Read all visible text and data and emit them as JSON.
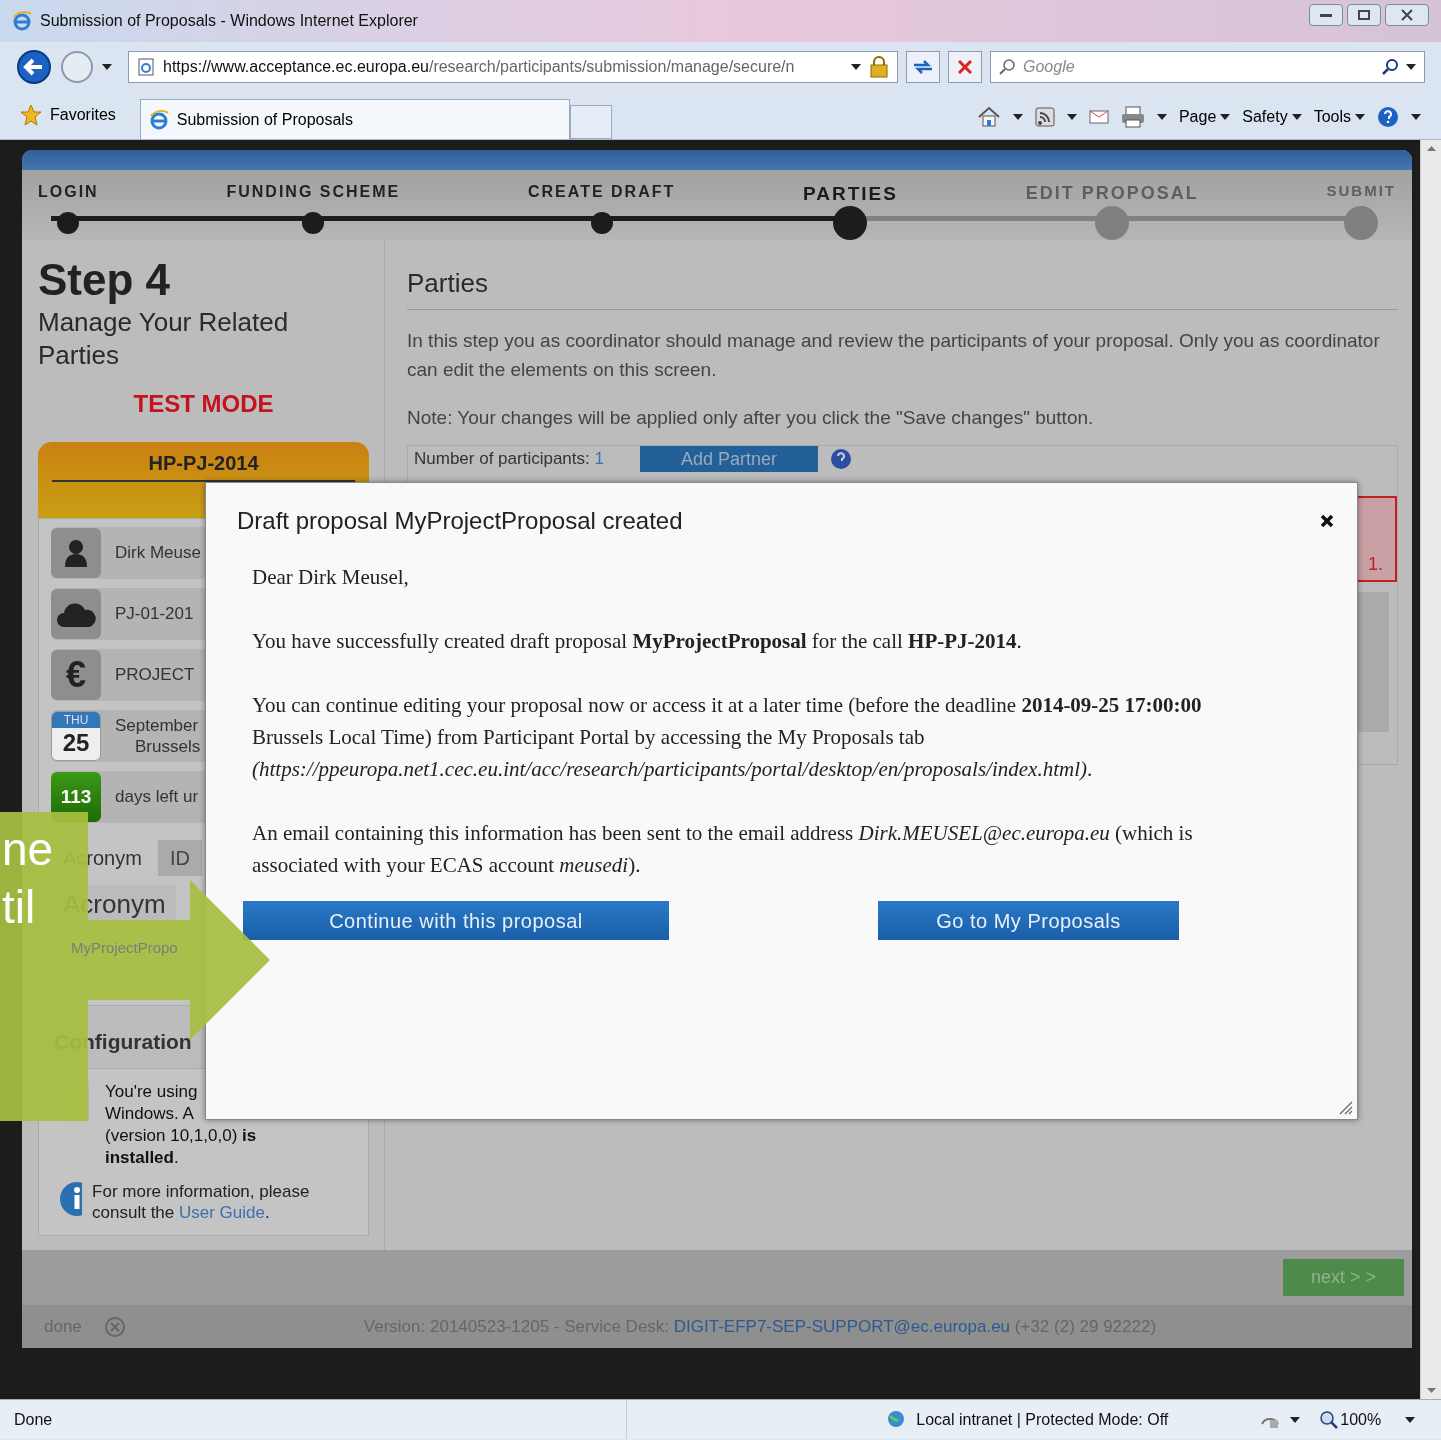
{
  "window": {
    "title": "Submission of Proposals - Windows Internet Explorer"
  },
  "address_bar": {
    "url_host": "https://www.acceptance.ec.europa.eu",
    "url_path": "/research/participants/submission/manage/secure/n"
  },
  "search": {
    "placeholder": "Google"
  },
  "favorites": {
    "label": "Favorites"
  },
  "browser_tabs": [
    {
      "label": "Submission of Proposals",
      "selected": true
    }
  ],
  "command_bar": [
    "Page",
    "Safety",
    "Tools"
  ],
  "steps": [
    {
      "label": "LOGIN",
      "selected": false
    },
    {
      "label": "FUNDING SCHEME",
      "selected": false
    },
    {
      "label": "CREATE DRAFT",
      "selected": false
    },
    {
      "label": "PARTIES",
      "selected": true
    },
    {
      "label": "EDIT PROPOSAL",
      "selected": false
    },
    {
      "label": "SUBMIT",
      "selected": false
    }
  ],
  "sidebar": {
    "step": "Step 4",
    "subtitle": "Manage Your Related Parties",
    "mode": "TEST MODE",
    "call": "HP-PJ-2014",
    "items": [
      {
        "kind": "person",
        "text": "Dirk Meuse"
      },
      {
        "kind": "cloud",
        "text": "PJ-01-201"
      },
      {
        "kind": "euro",
        "icon": "€",
        "text": "PROJECT"
      },
      {
        "kind": "date",
        "day_name": "THU",
        "day": "25",
        "text": "September",
        "text_2": "Brussels"
      },
      {
        "kind": "days",
        "count": "113",
        "text": "days left ur"
      }
    ],
    "tabs": [
      {
        "label": "Acronym",
        "selected": true
      },
      {
        "label": "ID",
        "selected": false
      }
    ],
    "field_label": "Acronym",
    "field_value": "MyProjectPropo",
    "config_title": "Configuration",
    "config_lines": [
      "You're using",
      "Windows. A",
      "(version 10,1,0,0) **is**",
      "**installed**."
    ],
    "info_text": "For more information, please consult the",
    "info_link": "User Guide",
    "info_end": "."
  },
  "main": {
    "title": "Parties",
    "intro": "In this step you as coordinator should manage and review the participants of your proposal. Only you as coordinator can edit the elements on this screen.",
    "note": "Note: Your changes will be applied only after you click the \"Save changes\" button.",
    "participants_label": "Number of participants:",
    "participants_count": "1",
    "add_button": "Add Partner",
    "side_note": "1."
  },
  "next_button": "next > >",
  "footer": {
    "status": "done",
    "version": "Version: 20140523-1205 - Service Desk:",
    "email": "DIGIT-EFP7-SEP-SUPPORT@ec.europa.eu",
    "phone": "(+32 (2) 29 92222)"
  },
  "dialog": {
    "title": "Draft proposal MyProjectProposal created",
    "paragraphs": [
      "Dear Dirk Meusel,",
      "You have successfully created draft proposal **MyProjectProposal** for the call **HP-PJ-2014**.",
      "You can continue editing your proposal now or access it at a later time (before the deadline **2014-09-25 17:00:00** Brussels Local Time) from Participant Portal by accessing the My Proposals tab *(https://ppeuropa.net1.cec.eu.int/acc/research/participants/portal/desktop/en/proposals/index.html)*.",
      "An email containing this information has been sent to the email address *Dirk.MEUSEL@ec.europa.eu* (which is associated with your ECAS account *meusedi*)."
    ],
    "buttons": [
      "Continue with this proposal",
      "Go to My Proposals"
    ]
  },
  "callout": {
    "lines": [
      "ne",
      "til"
    ]
  },
  "status_bar": {
    "text": "Done",
    "zone": "Local intranet | Protected Mode: Off",
    "zoom": "100%"
  }
}
